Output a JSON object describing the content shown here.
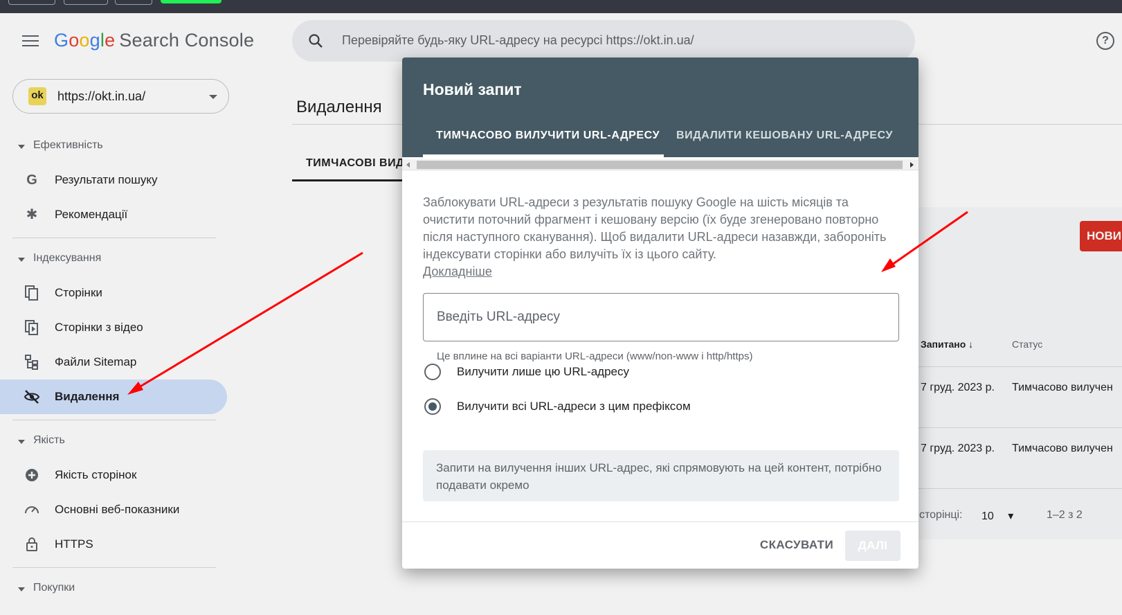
{
  "app": {
    "logo_parts": [
      "G",
      "o",
      "o",
      "g",
      "l",
      "e"
    ],
    "product_name": "Search Console"
  },
  "search": {
    "placeholder": "Перевіряйте будь-яку URL-адресу на ресурсі https://okt.in.ua/"
  },
  "property": {
    "favicon_text": "ok",
    "url": "https://okt.in.ua/"
  },
  "sidebar": {
    "sections": [
      {
        "title": "Ефективність",
        "items": [
          "Результати пошуку",
          "Рекомендації"
        ]
      },
      {
        "title": "Індексування",
        "items": [
          "Сторінки",
          "Сторінки з відео",
          "Файли Sitemap",
          "Видалення"
        ]
      },
      {
        "title": "Якість",
        "items": [
          "Якість сторінок",
          "Основні веб-показники",
          "HTTPS"
        ]
      },
      {
        "title": "Покупки",
        "items": []
      }
    ],
    "active_item": "Видалення"
  },
  "main": {
    "title": "Видалення",
    "tab_partial": "ТИМЧАСОВІ ВИД",
    "new_button": "НОВИ",
    "table": {
      "col_requested": "Запитано",
      "col_status": "Статус",
      "rows": [
        {
          "requested": "7 груд. 2023 р.",
          "status": "Тимчасово вилучен"
        },
        {
          "requested": "7 груд. 2023 р.",
          "status": "Тимчасово вилучен"
        }
      ],
      "rows_per_page_label": "сторінці:",
      "rows_per_page_value": "10",
      "range": "1–2 з 2"
    }
  },
  "dialog": {
    "title": "Новий запит",
    "tabs": [
      "ТИМЧАСОВО ВИЛУЧИТИ URL-АДРЕСУ",
      "ВИДАЛИТИ КЕШОВАНУ URL-АДРЕСУ"
    ],
    "description": "Заблокувати URL-адреси з результатів пошуку Google на шість місяців та очистити поточний фрагмент і кешовану версію (їх буде згенеровано повторно після наступного сканування). Щоб видалити URL-адреси назавжди, забороніть індексувати сторінки або вилучіть їх із цього сайту.",
    "learn_more": "Докладніше",
    "url_placeholder": "Введіть URL-адресу",
    "url_value": "",
    "hint": "Це вплине на всі варіанти URL-адреси (www/non-www і http/https)",
    "radio_options": [
      "Вилучити лише цю URL-адресу",
      "Вилучити всі URL-адреси з цим префіксом"
    ],
    "selected_option": "Вилучити всі URL-адреси з цим префіксом",
    "note": "Запити на вилучення інших URL-адрес, які спрямовують на цей контент, потрібно подавати окремо",
    "cancel_label": "СКАСУВАТИ",
    "next_label": "ДАЛІ"
  },
  "colors": {
    "dialog_header": "#455a64",
    "active_nav": "#d3e3fd",
    "new_button": "#d93025",
    "annotation_arrow": "#ff0000"
  }
}
